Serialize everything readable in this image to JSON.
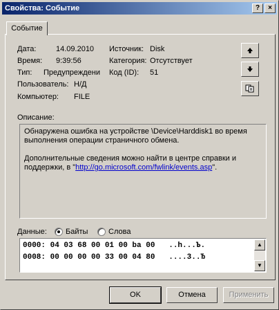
{
  "window": {
    "title": "Свойства: Событие",
    "help_btn": "?",
    "close_btn": "×"
  },
  "tab": "Событие",
  "fields": {
    "date_label": "Дата:",
    "date_value": "14.09.2010",
    "time_label": "Время:",
    "time_value": "9:39:56",
    "type_label": "Тип:",
    "type_value": "Предупреждени",
    "user_label": "Пользователь:",
    "user_value": "Н/Д",
    "computer_label": "Компьютер:",
    "computer_value": "FILE",
    "source_label": "Источник:",
    "source_value": "Disk",
    "category_label": "Категория:",
    "category_value": "Отсутствует",
    "code_label": "Код (ID):",
    "code_value": "51"
  },
  "description": {
    "label": "Описание:",
    "para1": "Обнаружена ошибка на устройстве \\Device\\Harddisk1 во время выполнения операции страничного обмена.",
    "para2_prefix": "Дополнительные сведения можно найти в центре справки и поддержки, в \"",
    "link": "http://go.microsoft.com/fwlink/events.asp",
    "para2_suffix": "\"."
  },
  "data": {
    "label": "Данные:",
    "opt_bytes": "Байты",
    "opt_words": "Слова",
    "selected": "bytes",
    "lines": [
      "0000: 04 03 68 00 01 00 ba 00   ..h...Ъ.",
      "0008: 00 00 00 00 33 00 04 80   ....3..Ђ"
    ]
  },
  "buttons": {
    "ok": "OK",
    "cancel": "Отмена",
    "apply": "Применить"
  },
  "icons": {
    "up": "arrow-up-icon",
    "down": "arrow-down-icon",
    "copy": "copy-icon"
  }
}
